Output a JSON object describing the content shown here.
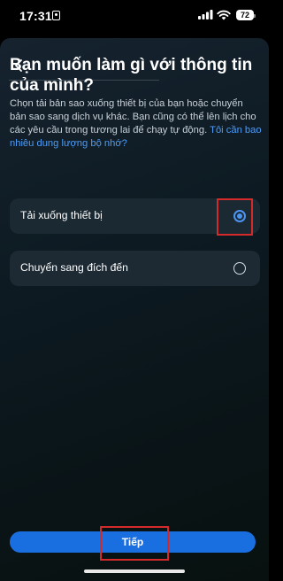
{
  "status_bar": {
    "time": "17:31",
    "battery": "72"
  },
  "header": {
    "back_icon": "chevron-left-icon"
  },
  "title": "Bạn muốn làm gì với thông tin của mình?",
  "description": {
    "text": "Chọn tải bản sao xuống thiết bị của bạn hoặc chuyển bản sao sang dịch vụ khác. Bạn cũng có thể lên lịch cho các yêu cầu trong tương lai để chạy tự động. ",
    "link": "Tôi cần bao nhiêu dung lượng bộ nhớ?"
  },
  "options": [
    {
      "label": "Tải xuống thiết bị",
      "selected": true
    },
    {
      "label": "Chuyển sang đích đến",
      "selected": false
    }
  ],
  "next_button": {
    "label": "Tiếp"
  },
  "colors": {
    "accent": "#1a6fe0",
    "link": "#4e9cf5",
    "highlight": "#d42a2a"
  }
}
